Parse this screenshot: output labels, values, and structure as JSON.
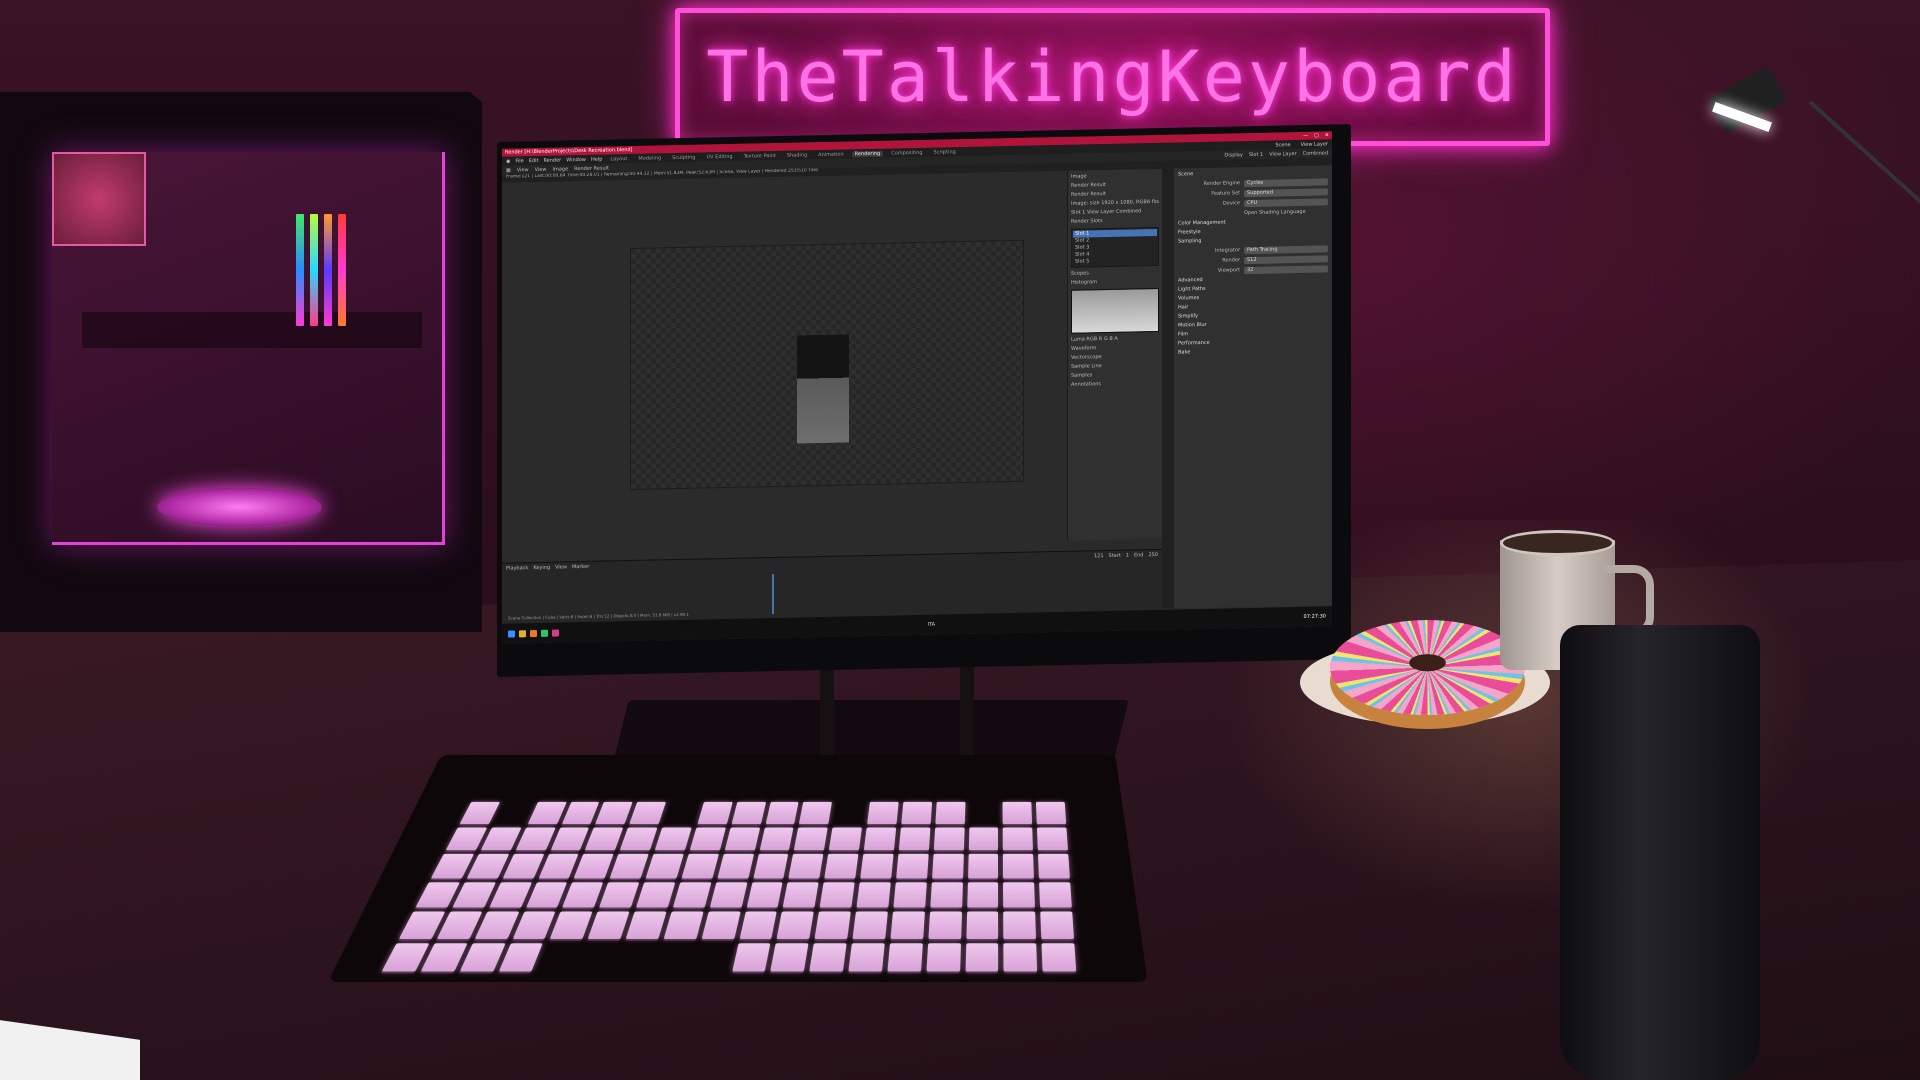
{
  "neon_sign": {
    "text": "TheTalkingKeyboard"
  },
  "blender": {
    "window_title": "Render [H:\\BlenderProjects\\Desk Recreation.blend]",
    "menus": [
      "File",
      "Edit",
      "Render",
      "Window",
      "Help"
    ],
    "workspaces": [
      "Layout",
      "Modeling",
      "Sculpting",
      "UV Editing",
      "Texture Paint",
      "Shading",
      "Animation",
      "Rendering",
      "Compositing",
      "Scripting"
    ],
    "active_workspace": "Rendering",
    "scene": "Scene",
    "view_layer": "View Layer",
    "image_editor": {
      "menu": [
        "View",
        "View",
        "Image"
      ],
      "image_name": "Render Result",
      "display": "Display",
      "slot": "Slot 1",
      "layer": "View Layer",
      "pass": "Combined",
      "status_line": "Frame:121 | Last:00:00.84 Time:00:28.01 | Remaining:00:44.12 | Mem:51.83M, Peak:52.63M | Scene, View Layer | Rendered 253/510 Tiles"
    },
    "n_panel": {
      "image_header": "Image",
      "image_name": "Render Result",
      "render_result": "Render Result",
      "image_size": "Image: size 1920 x 1080, RGBA float",
      "slot_row": [
        "Slot 1",
        "View Layer",
        "Combined"
      ],
      "render_slots_header": "Render Slots",
      "slots": [
        "Slot 1",
        "Slot 2",
        "Slot 3",
        "Slot 4",
        "Slot 5"
      ],
      "scopes_header": "Scopes",
      "histogram_header": "Histogram",
      "channels": [
        "Luma",
        "RGB",
        "R",
        "G",
        "B",
        "A"
      ],
      "subpanels": [
        "Waveform",
        "Vectorscope",
        "Sample Line",
        "Samples",
        "Annotations"
      ]
    },
    "properties": {
      "header": "Scene",
      "rows": [
        {
          "label": "Render Engine",
          "value": "Cycles"
        },
        {
          "label": "Feature Set",
          "value": "Supported"
        },
        {
          "label": "Device",
          "value": "CPU"
        }
      ],
      "osl": "Open Shading Language",
      "sections": [
        "Color Management",
        "Freestyle",
        "Sampling"
      ],
      "integrator": {
        "label": "Integrator",
        "value": "Path Tracing"
      },
      "samples": [
        {
          "label": "Render",
          "value": "512"
        },
        {
          "label": "Viewport",
          "value": "32"
        }
      ],
      "more_sections": [
        "Advanced",
        "Light Paths",
        "Volumes",
        "Hair",
        "Simplify",
        "Motion Blur",
        "Film",
        "Performance",
        "Bake"
      ]
    },
    "timeline": {
      "menus": [
        "Playback",
        "Keying",
        "View",
        "Marker"
      ],
      "current_frame": "121",
      "start_label": "Start",
      "start": "1",
      "end_label": "End",
      "end": "250"
    },
    "status_bar": "Scene Collection | Cube | Verts:8 | Faces:6 | Tris:12 | Objects:0/3 | Mem: 51.8 MiB | v2.90.1",
    "taskbar": {
      "lang": "ITA",
      "time": "07:27:30"
    }
  },
  "colors": {
    "neon": "#ff4fd8",
    "blender_title": "#b2133b",
    "slot_selected": "#4772b3"
  }
}
